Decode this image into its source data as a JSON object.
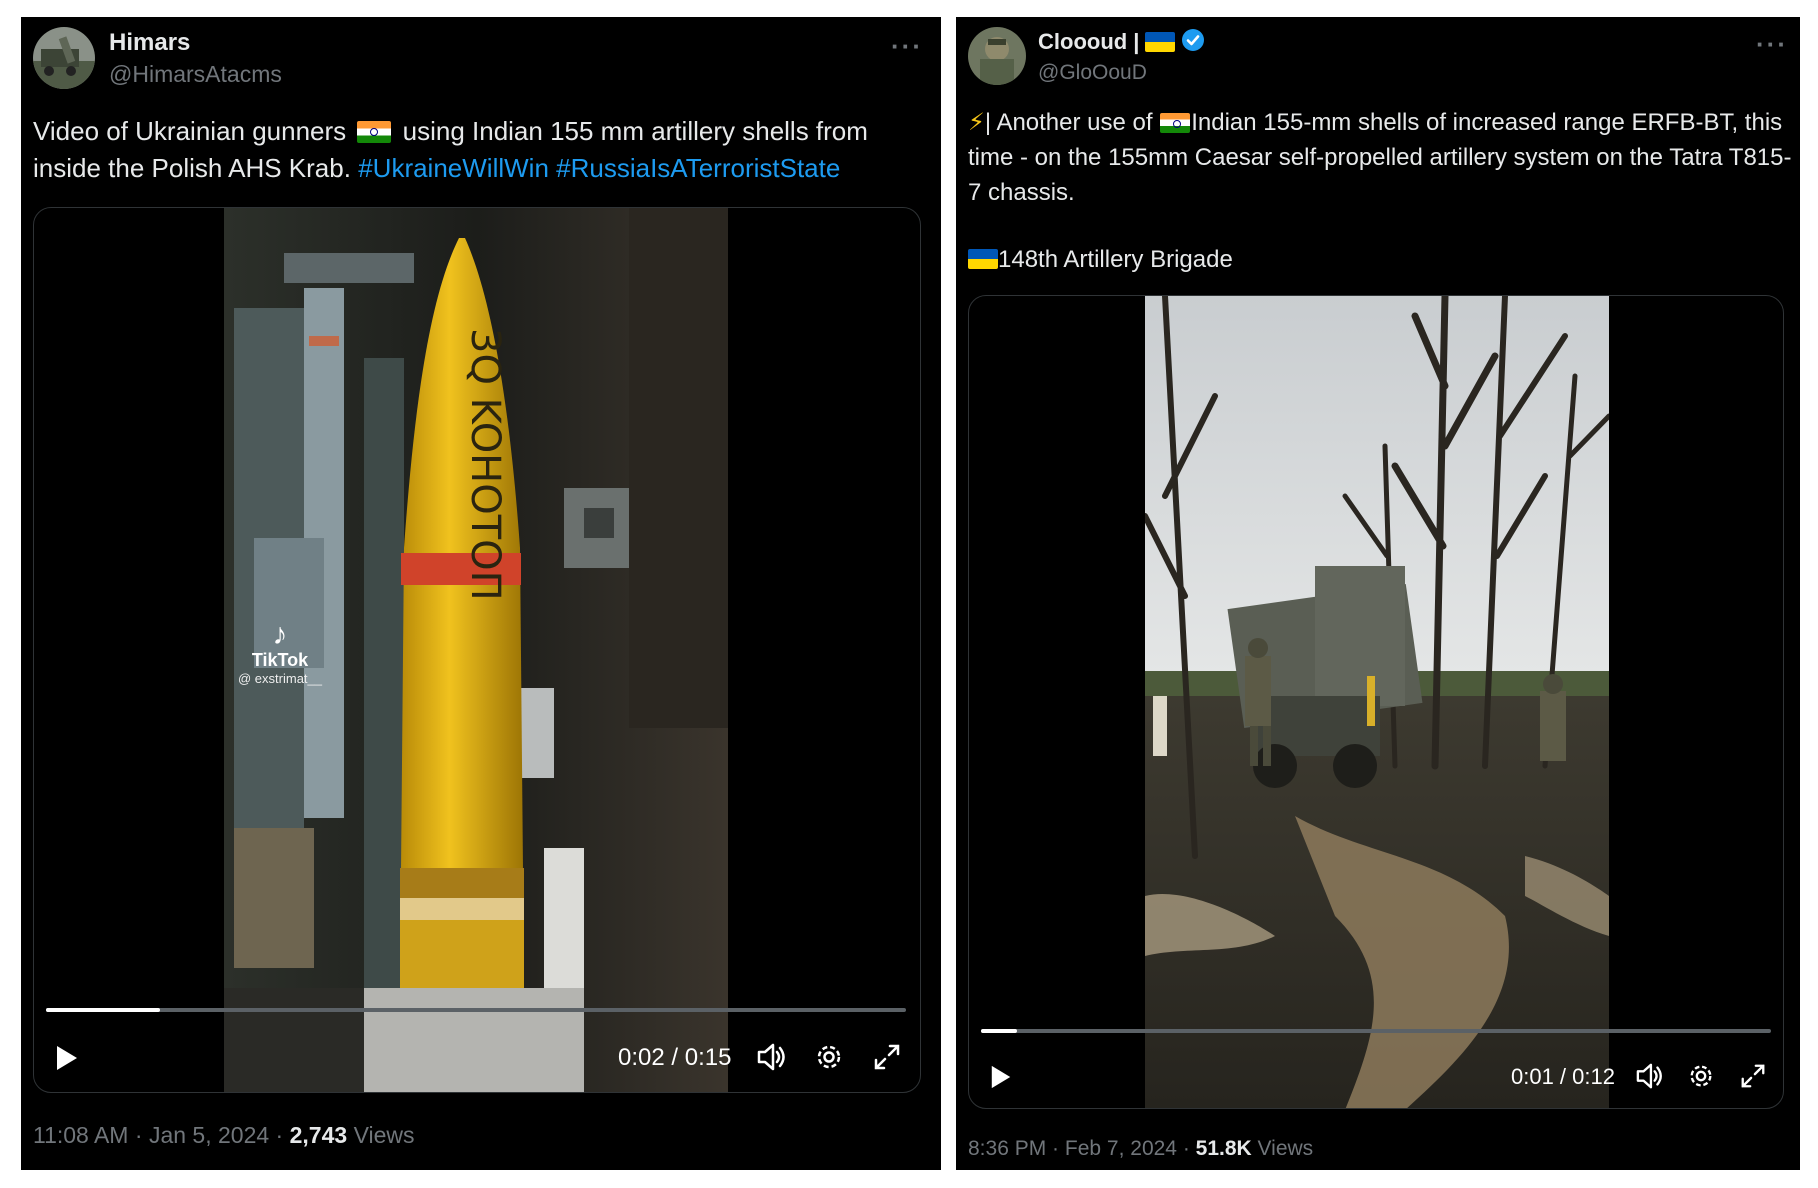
{
  "left_tweet": {
    "display_name": "Himars",
    "handle": "@HimarsAtacms",
    "text_before_flag": "Video of Ukrainian gunners",
    "text_after_flag": " using Indian 155 mm artillery shells from inside the Polish AHS Krab.",
    "hashtags": [
      "#UkraineWillWin",
      "#RussiaIsATerroristState"
    ],
    "video": {
      "progress": 0.133,
      "time": "0:02 / 0:15",
      "shell_marking": "3Q KOHOTOП",
      "watermark_brand": "TikTok",
      "watermark_user": "@ exstrimat__"
    },
    "meta": {
      "time": "11:08 AM",
      "date": "Jan 5, 2024",
      "views_count": "2,743",
      "views_label": "Views"
    },
    "more_icon": "···"
  },
  "right_tweet": {
    "display_name": "Cloooud |",
    "handle": "@GloOouD",
    "text_line_intro": "| Another use of ",
    "text_after_flag": "Indian 155-mm shells of increased range ERFB-BT, this time - on the 155mm Caesar self-propelled artillery system on the Tatra T815-7 chassis.",
    "brigade": "148th Artillery Brigade",
    "video": {
      "progress": 0.045,
      "time": "0:01 / 0:12"
    },
    "meta": {
      "time": "8:36 PM",
      "date": "Feb 7, 2024",
      "views_count": "51.8K",
      "views_label": "Views"
    },
    "more_icon": "···"
  },
  "separator": " · ",
  "colors": {
    "tweet_bg": "#000000",
    "text": "#e7e9ea",
    "muted": "#71767b",
    "link": "#1d9bf0",
    "verified": "#1d9bf0"
  },
  "icons": [
    "play-icon",
    "volume-icon",
    "settings-icon",
    "fullscreen-icon",
    "more-icon",
    "verified-badge-icon",
    "lightning-icon",
    "india-flag-icon",
    "ukraine-flag-icon",
    "tiktok-icon"
  ]
}
